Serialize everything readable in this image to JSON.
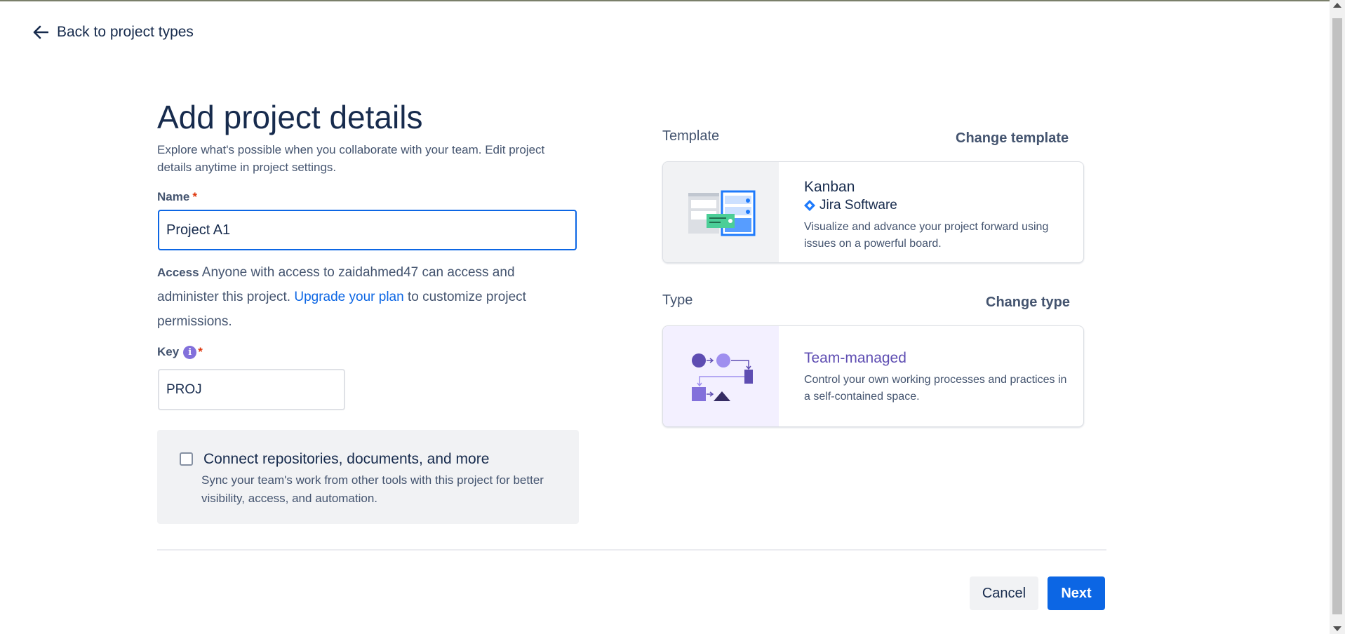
{
  "nav": {
    "back_label": "Back to project types"
  },
  "header": {
    "title": "Add project details",
    "subtitle": "Explore what's possible when you collaborate with your team. Edit project details anytime in project settings."
  },
  "form": {
    "name_label": "Name",
    "name_value": "Project A1",
    "required_mark": "*",
    "access_label": "Access",
    "access_text_1": "Anyone with access to zaidahmed47 can access and administer this project.",
    "upgrade_link": "Upgrade your plan",
    "access_text_2": "to customize project permissions.",
    "key_label": "Key",
    "key_value": "PROJ",
    "connect_title": "Connect repositories, documents, and more",
    "connect_desc": "Sync your team's work from other tools with this project for better visibility, access, and automation.",
    "connect_checked": false
  },
  "template": {
    "section_label": "Template",
    "change_label": "Change template",
    "name": "Kanban",
    "product": "Jira Software",
    "description": "Visualize and advance your project forward using issues on a powerful board."
  },
  "type": {
    "section_label": "Type",
    "change_label": "Change type",
    "name": "Team-managed",
    "description": "Control your own working processes and practices in a self-contained space."
  },
  "actions": {
    "cancel": "Cancel",
    "next": "Next"
  },
  "colors": {
    "primary": "#0c66e4",
    "team_managed_accent": "#5e4db2",
    "required": "#de350b"
  }
}
